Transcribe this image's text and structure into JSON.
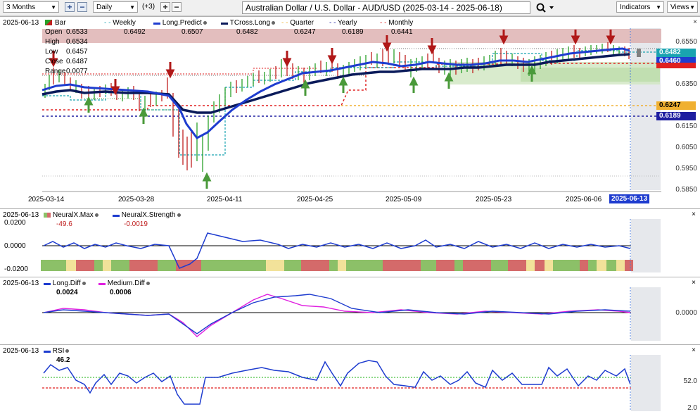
{
  "toolbar": {
    "period": "3 Months",
    "interval": "Daily",
    "offset": "(+3)",
    "title": "Australian Dollar / U.S. Dollar - AUD/USD (2025-03-14 - 2025-06-18)",
    "indicators_label": "Indicators",
    "views_label": "Views"
  },
  "main": {
    "date": "2025-06-13",
    "legend": {
      "bar": "Bar",
      "weekly": "Weekly",
      "long_predict": "Long.Predict",
      "tcross": "TCross.Long",
      "quarter": "Quarter",
      "yearly": "Yearly",
      "monthly": "Monthly"
    },
    "ohlc": {
      "open_label": "Open",
      "open": "0.6533",
      "high_label": "High",
      "high": "0.6534",
      "low_label": "Low",
      "low": "0.6457",
      "close_label": "Close",
      "close": "0.6487",
      "range_label": "Range",
      "range": "0.0077"
    },
    "values": {
      "weekly": "0.6492",
      "long_predict": "0.6507",
      "tcross": "0.6482",
      "quarter": "0.6247",
      "yearly": "0.6189",
      "monthly": "0.6441"
    },
    "y_axis": [
      "0.6550",
      "0.6350",
      "0.6150",
      "0.6050",
      "0.5950",
      "0.5850"
    ],
    "price_tags": [
      {
        "value": "0.6482",
        "color": "#19a3b0"
      },
      {
        "value": "0.6460",
        "color": "#1e3ccf"
      },
      {
        "value": "0.6441",
        "color": "#e02020"
      },
      {
        "value": "0.6247",
        "color": "#f0b030"
      },
      {
        "value": "0.6189",
        "color": "#1e1ea0"
      }
    ],
    "x_axis": [
      "2025-03-14",
      "2025-03-28",
      "2025-04-11",
      "2025-04-25",
      "2025-05-09",
      "2025-05-23",
      "2025-06-06"
    ],
    "current_date": "2025-06-13"
  },
  "neuralx": {
    "date": "2025-06-13",
    "max_label": "NeuralX.Max",
    "max_value": "-49.6",
    "strength_label": "NeuralX.Strength",
    "strength_value": "-0.0019",
    "y_axis": [
      "0.0200",
      "0.0000",
      "-0.0200"
    ]
  },
  "diff": {
    "date": "2025-06-13",
    "long_label": "Long.Diff",
    "long_value": "0.0024",
    "medium_label": "Medium.Diff",
    "medium_value": "0.0006",
    "y_axis": [
      "0.0000"
    ]
  },
  "rsi": {
    "date": "2025-06-13",
    "label": "RSI",
    "value": "46.2",
    "y_axis": [
      "52.0",
      "2.0"
    ]
  },
  "colors": {
    "long_predict": "#1e3ccf",
    "tcross": "#0a1a5a",
    "weekly": "#19a3b0",
    "monthly": "#e02020",
    "quarter": "#f0b030",
    "yearly": "#1e1ea0",
    "up_arrow": "#4a9a3a",
    "down_arrow": "#b01818"
  }
}
